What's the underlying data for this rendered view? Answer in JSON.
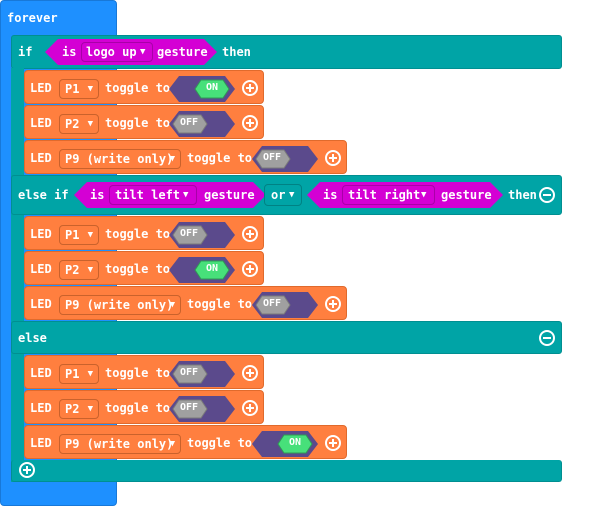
{
  "forever": {
    "label": "forever"
  },
  "if_block": {
    "if_label": "if",
    "then_label": "then",
    "else_if_label": "else if",
    "else_label": "else",
    "or_label": "or"
  },
  "gesture": {
    "is_label": "is",
    "gesture_label": "gesture",
    "logo_up": "logo up",
    "tilt_left": "tilt left",
    "tilt_right": "tilt right"
  },
  "led": {
    "led_label": "LED",
    "toggle_label": "toggle to",
    "on_label": "ON",
    "off_label": "OFF"
  },
  "pins": {
    "p1": "P1",
    "p2": "P2",
    "p9": "P9 (write only)"
  },
  "colors": {
    "forever": "#1e90ff",
    "logic": "#00a4a6",
    "led": "#ff7f3f",
    "gesture": "#d400d4",
    "toggle_on": "#47e07a",
    "toggle_off": "#a0a0a0",
    "toggle_bg": "#5b4a8c"
  }
}
